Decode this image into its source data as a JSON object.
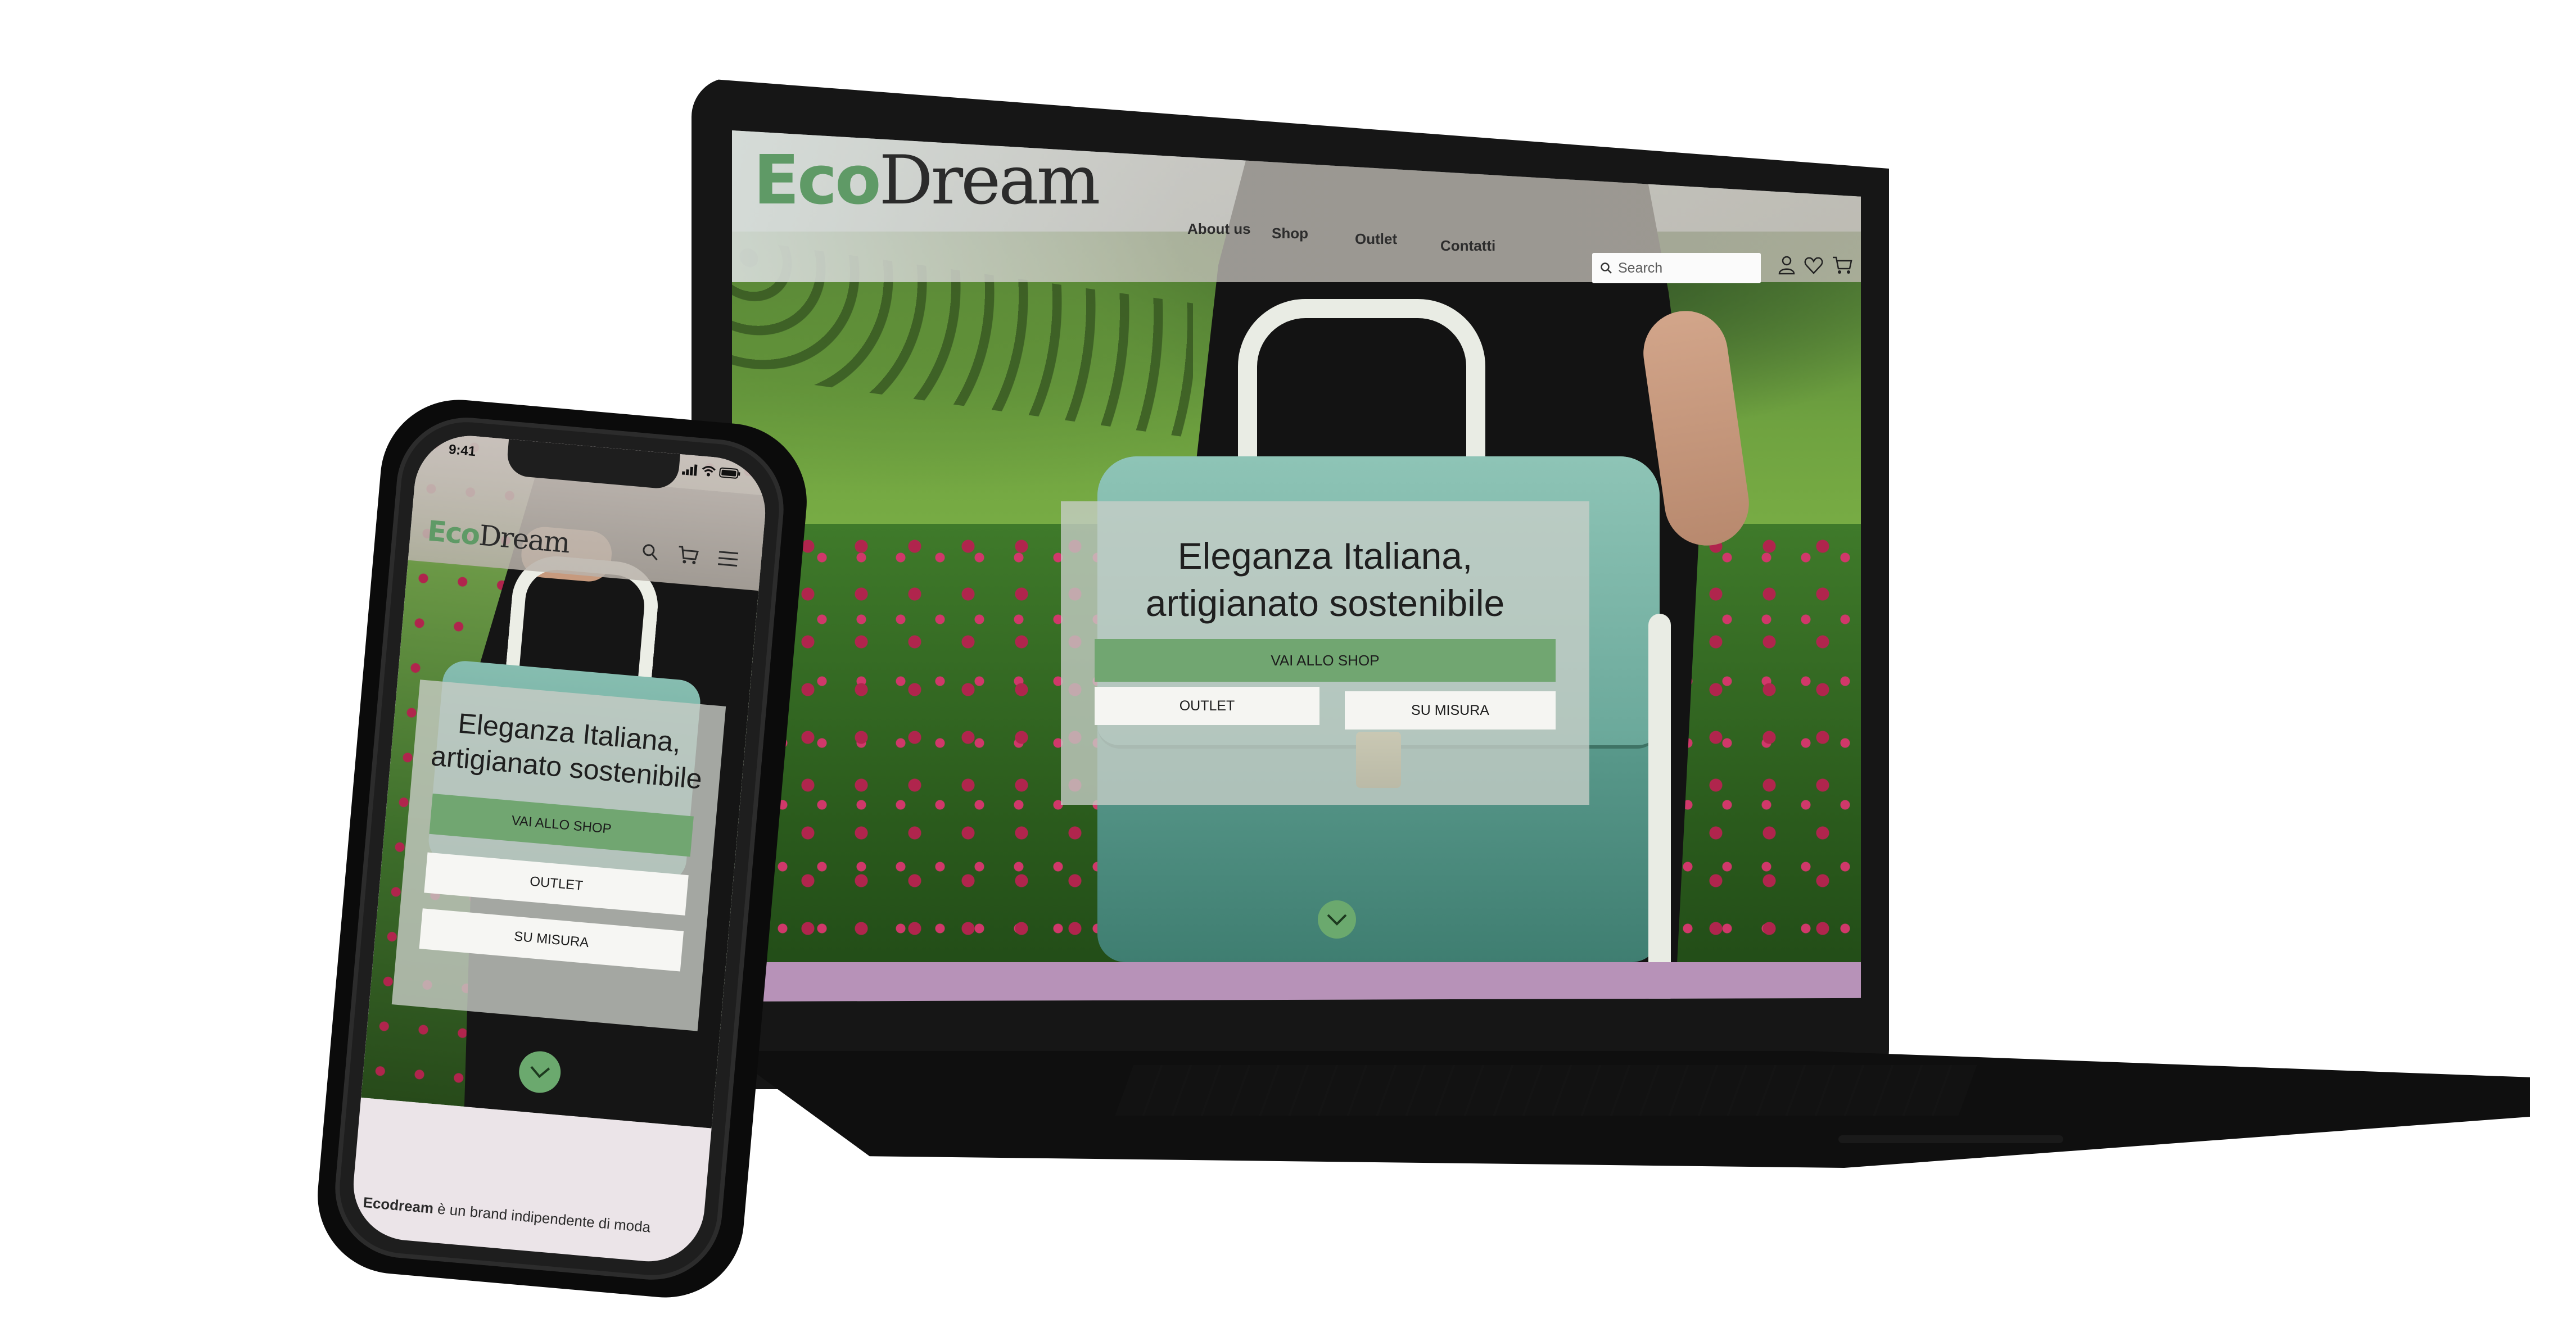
{
  "laptop_site": {
    "logo": {
      "part1": "Eco",
      "part2": "Dream"
    },
    "nav": [
      "About us",
      "Shop",
      "Outlet",
      "Contatti"
    ],
    "search_placeholder": "Search",
    "hero": {
      "title": "Eleganza Italiana,\nartigianato sostenibile",
      "primary_button": "VAI ALLO SHOP",
      "secondary_button_1": "OUTLET",
      "secondary_button_2": "SU MISURA"
    }
  },
  "phone_site": {
    "status_time": "9:41",
    "logo": {
      "part1": "Eco",
      "part2": "Dream"
    },
    "hero": {
      "title": "Eleganza Italiana,\nartigianato sostenibile",
      "primary_button": "VAI ALLO SHOP",
      "secondary_button_1": "OUTLET",
      "secondary_button_2": "SU MISURA"
    },
    "footer_text_bold": "Ecodream",
    "footer_text": " è un brand indipendente di moda"
  },
  "colors": {
    "brand_green": "#71a671",
    "logo_green": "#5f9a66",
    "accent_purple": "#b792b8",
    "device_black": "#161616"
  },
  "icons": [
    "search-icon",
    "user-icon",
    "heart-icon",
    "cart-icon",
    "menu-icon",
    "chevron-down-icon",
    "signal-icon",
    "wifi-icon",
    "battery-icon"
  ]
}
